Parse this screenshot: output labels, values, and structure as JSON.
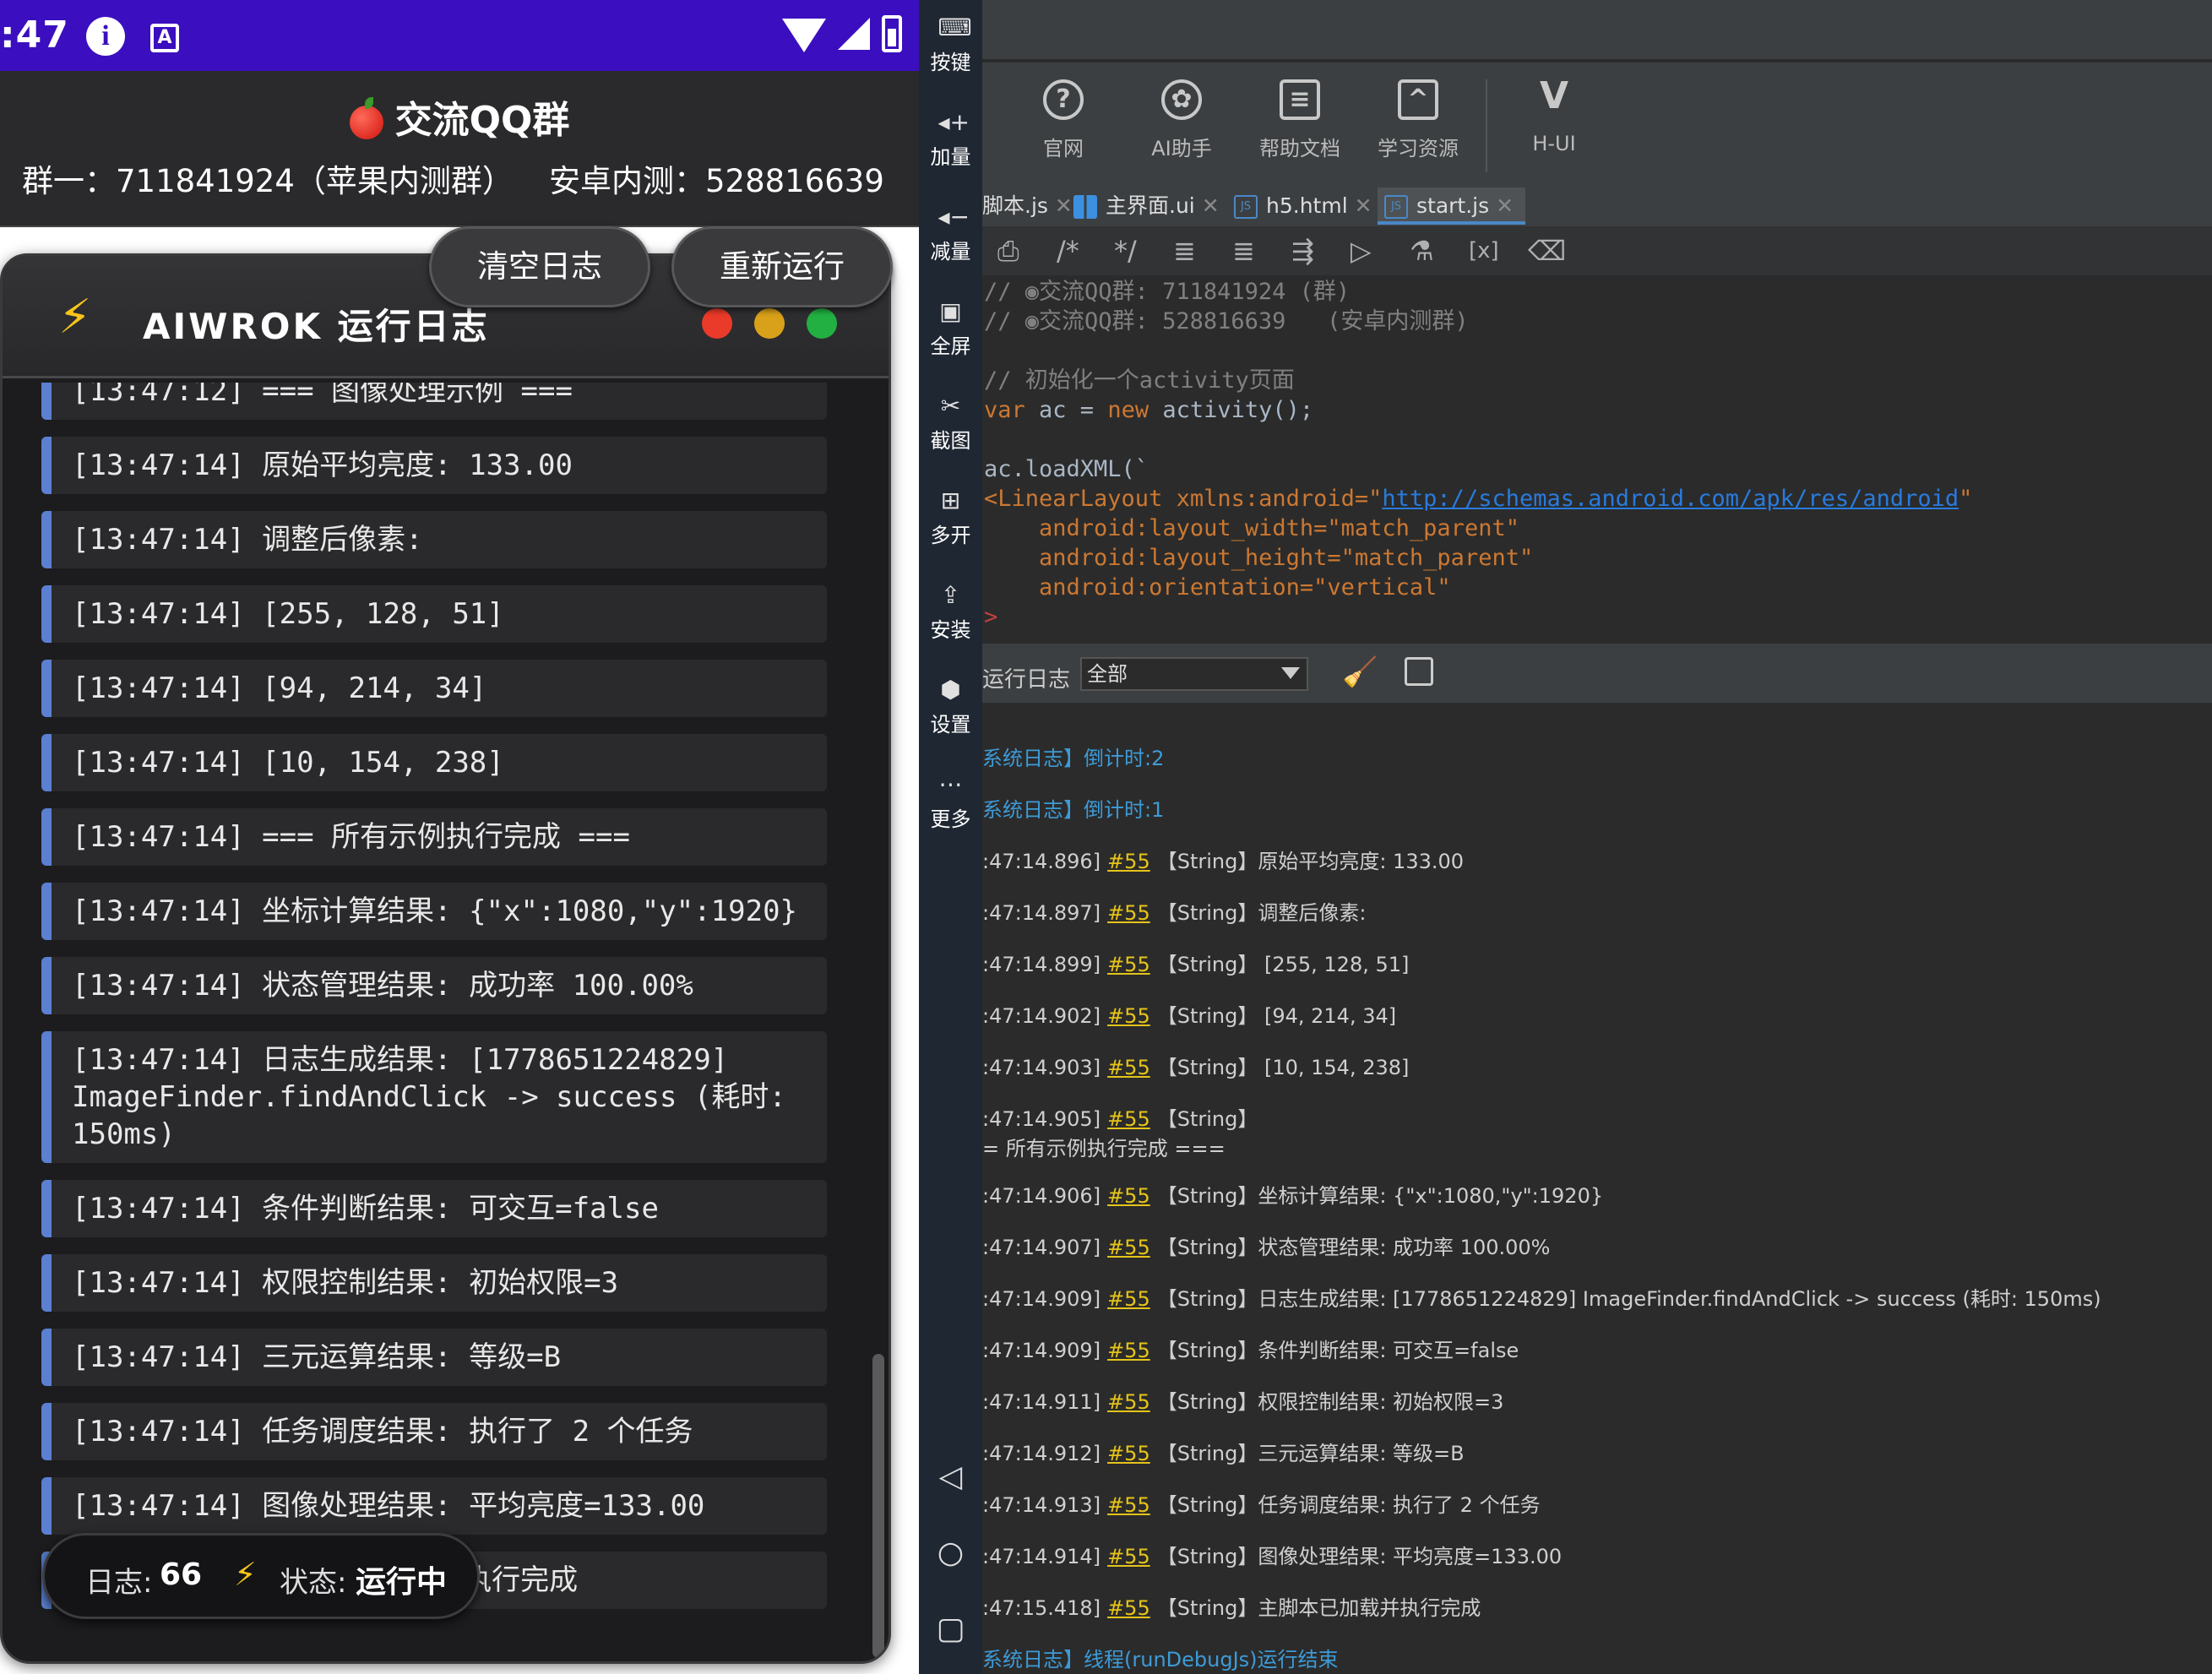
{
  "phone": {
    "statusbar": {
      "time": ":47",
      "info_icon": "info-icon",
      "a_icon": "A",
      "icons": [
        "wifi-icon",
        "signal-icon",
        "battery-icon"
      ]
    },
    "qq": {
      "title": "交流QQ群",
      "group1": "群一：711841924（苹果内测群）",
      "group2": "安卓内测：528816639"
    },
    "log_panel": {
      "title": "AIWROK 运行日志",
      "clear_button": "清空日志",
      "rerun_button": "重新运行",
      "entries": [
        "[13:47:12] === 图像处理示例 ===",
        "[13:47:14] 原始平均亮度: 133.00",
        "[13:47:14] 调整后像素:",
        "[13:47:14] [255, 128, 51]",
        "[13:47:14] [94, 214, 34]",
        "[13:47:14] [10, 154, 238]",
        "[13:47:14] === 所有示例执行完成 ===",
        "[13:47:14] 坐标计算结果: {\"x\":1080,\"y\":1920}",
        "[13:47:14] 状态管理结果: 成功率 100.00%",
        "[13:47:14] 日志生成结果: [1778651224829]\nImageFinder.findAndClick -> success (耗时:\n150ms)",
        "[13:47:14] 条件判断结果: 可交互=false",
        "[13:47:14] 权限控制结果: 初始权限=3",
        "[13:47:14] 三元运算结果: 等级=B",
        "[13:47:14] 任务调度结果: 执行了 2 个任务",
        "[13:47:14] 图像处理结果: 平均亮度=133.00",
        "[13:47:14] 主脚本已加载并执行完成"
      ],
      "status": {
        "log_label": "日志:",
        "log_count": "66",
        "state_label": "状态:",
        "state_value": "运行中"
      }
    }
  },
  "side_tools": [
    {
      "label": "按键",
      "icon": "keyboard-icon"
    },
    {
      "label": "加量",
      "icon": "volume-up-icon"
    },
    {
      "label": "减量",
      "icon": "volume-down-icon"
    },
    {
      "label": "全屏",
      "icon": "fullscreen-icon"
    },
    {
      "label": "截图",
      "icon": "scissors-icon"
    },
    {
      "label": "多开",
      "icon": "multi-window-icon"
    },
    {
      "label": "安装",
      "icon": "apk-install-icon"
    },
    {
      "label": "设置",
      "icon": "settings-icon"
    },
    {
      "label": "更多",
      "icon": "more-icon"
    }
  ],
  "nav": [
    "back-icon",
    "home-icon",
    "recents-icon"
  ],
  "ide": {
    "toolbar": [
      {
        "label": "官网",
        "icon": "help-circle-icon"
      },
      {
        "label": "AI助手",
        "icon": "ai-icon"
      },
      {
        "label": "帮助文档",
        "icon": "document-icon"
      },
      {
        "label": "学习资源",
        "icon": "graduation-cap-icon"
      },
      {
        "label": "H-UI",
        "icon": "h-ui-logo-icon"
      }
    ],
    "tabs": [
      "脚本.js",
      "主界面.ui",
      "h5.html",
      "start.js"
    ],
    "active_tab": "start.js",
    "code": {
      "line1": "// ",
      "line1b": "交流QQ群: 711841924 (群)",
      "line2": "// ",
      "line2b": "交流QQ群: 528816639   (安卓内测群)",
      "line3": "// 初始化一个activity页面",
      "line4a": "var",
      "line4b": " ac = ",
      "line4c": "new",
      "line4d": " activity();",
      "line5": "ac.loadXML(`",
      "line6a": "<LinearLayout xmlns:android=\"",
      "line6url": "http://schemas.android.com/apk/res/android",
      "line6b": "\"",
      "line7": "    android:layout_width=\"match_parent\"",
      "line8": "    android:layout_height=\"match_parent\"",
      "line9": "    android:orientation=\"vertical\"",
      "line10": ">"
    },
    "console": {
      "label": "运行日志",
      "filter": "全部",
      "lines": [
        {
          "prefix": "系统日志】倒计时:2",
          "sys": true
        },
        {
          "prefix": "系统日志】倒计时:1",
          "sys": true
        },
        {
          "prefix": ":47:14.896]",
          "line": "#55",
          "text": "【String】原始平均亮度: 133.00"
        },
        {
          "prefix": ":47:14.897]",
          "line": "#55",
          "text": "【String】调整后像素:"
        },
        {
          "prefix": ":47:14.899]",
          "line": "#55",
          "text": "【String】 [255, 128, 51]"
        },
        {
          "prefix": ":47:14.902]",
          "line": "#55",
          "text": "【String】 [94, 214, 34]"
        },
        {
          "prefix": ":47:14.903]",
          "line": "#55",
          "text": "【String】 [10, 154, 238]"
        },
        {
          "prefix": ":47:14.905]",
          "line": "#55",
          "text": "【String】",
          "cont": "= 所有示例执行完成 ==="
        },
        {
          "prefix": ":47:14.906]",
          "line": "#55",
          "text": "【String】坐标计算结果: {\"x\":1080,\"y\":1920}"
        },
        {
          "prefix": ":47:14.907]",
          "line": "#55",
          "text": "【String】状态管理结果: 成功率 100.00%"
        },
        {
          "prefix": ":47:14.909]",
          "line": "#55",
          "text": "【String】日志生成结果: [1778651224829] ImageFinder.findAndClick -> success (耗时: 150ms)"
        },
        {
          "prefix": ":47:14.909]",
          "line": "#55",
          "text": "【String】条件判断结果: 可交互=false"
        },
        {
          "prefix": ":47:14.911]",
          "line": "#55",
          "text": "【String】权限控制结果: 初始权限=3"
        },
        {
          "prefix": ":47:14.912]",
          "line": "#55",
          "text": "【String】三元运算结果: 等级=B"
        },
        {
          "prefix": ":47:14.913]",
          "line": "#55",
          "text": "【String】任务调度结果: 执行了 2 个任务"
        },
        {
          "prefix": ":47:14.914]",
          "line": "#55",
          "text": "【String】图像处理结果: 平均亮度=133.00"
        },
        {
          "prefix": ":47:15.418]",
          "line": "#55",
          "text": "【String】主脚本已加载并执行完成"
        },
        {
          "prefix": "系统日志】线程(runDebugJs)运行结束",
          "sys": true
        }
      ]
    }
  }
}
